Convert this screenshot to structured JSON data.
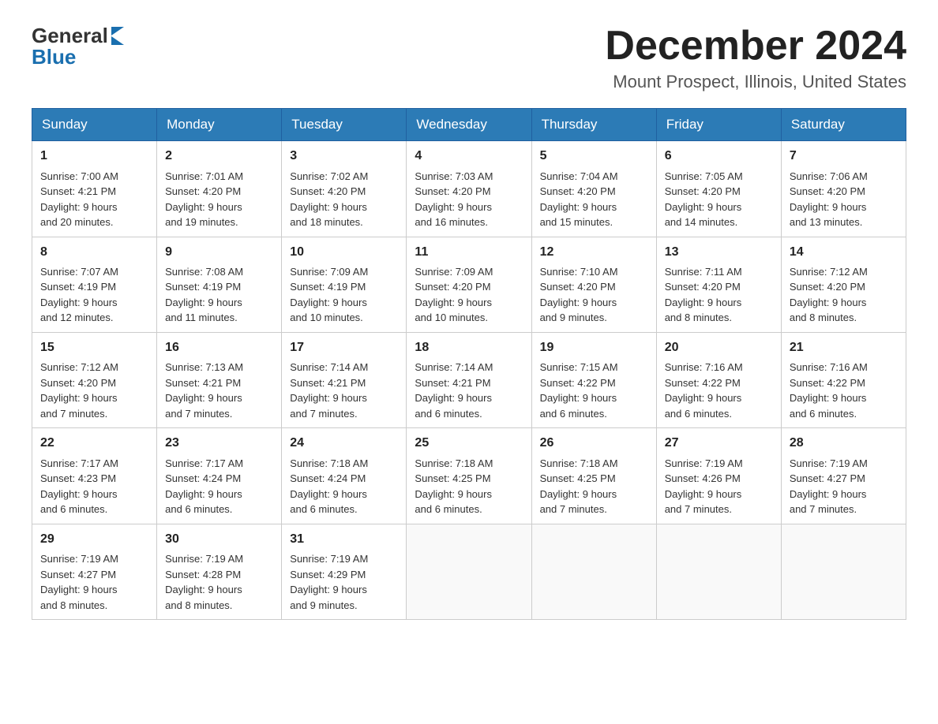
{
  "header": {
    "logo_general": "General",
    "logo_blue": "Blue",
    "month_title": "December 2024",
    "location": "Mount Prospect, Illinois, United States"
  },
  "weekdays": [
    "Sunday",
    "Monday",
    "Tuesday",
    "Wednesday",
    "Thursday",
    "Friday",
    "Saturday"
  ],
  "weeks": [
    [
      {
        "day": "1",
        "sunrise": "7:00 AM",
        "sunset": "4:21 PM",
        "daylight": "9 hours and 20 minutes."
      },
      {
        "day": "2",
        "sunrise": "7:01 AM",
        "sunset": "4:20 PM",
        "daylight": "9 hours and 19 minutes."
      },
      {
        "day": "3",
        "sunrise": "7:02 AM",
        "sunset": "4:20 PM",
        "daylight": "9 hours and 18 minutes."
      },
      {
        "day": "4",
        "sunrise": "7:03 AM",
        "sunset": "4:20 PM",
        "daylight": "9 hours and 16 minutes."
      },
      {
        "day": "5",
        "sunrise": "7:04 AM",
        "sunset": "4:20 PM",
        "daylight": "9 hours and 15 minutes."
      },
      {
        "day": "6",
        "sunrise": "7:05 AM",
        "sunset": "4:20 PM",
        "daylight": "9 hours and 14 minutes."
      },
      {
        "day": "7",
        "sunrise": "7:06 AM",
        "sunset": "4:20 PM",
        "daylight": "9 hours and 13 minutes."
      }
    ],
    [
      {
        "day": "8",
        "sunrise": "7:07 AM",
        "sunset": "4:19 PM",
        "daylight": "9 hours and 12 minutes."
      },
      {
        "day": "9",
        "sunrise": "7:08 AM",
        "sunset": "4:19 PM",
        "daylight": "9 hours and 11 minutes."
      },
      {
        "day": "10",
        "sunrise": "7:09 AM",
        "sunset": "4:19 PM",
        "daylight": "9 hours and 10 minutes."
      },
      {
        "day": "11",
        "sunrise": "7:09 AM",
        "sunset": "4:20 PM",
        "daylight": "9 hours and 10 minutes."
      },
      {
        "day": "12",
        "sunrise": "7:10 AM",
        "sunset": "4:20 PM",
        "daylight": "9 hours and 9 minutes."
      },
      {
        "day": "13",
        "sunrise": "7:11 AM",
        "sunset": "4:20 PM",
        "daylight": "9 hours and 8 minutes."
      },
      {
        "day": "14",
        "sunrise": "7:12 AM",
        "sunset": "4:20 PM",
        "daylight": "9 hours and 8 minutes."
      }
    ],
    [
      {
        "day": "15",
        "sunrise": "7:12 AM",
        "sunset": "4:20 PM",
        "daylight": "9 hours and 7 minutes."
      },
      {
        "day": "16",
        "sunrise": "7:13 AM",
        "sunset": "4:21 PM",
        "daylight": "9 hours and 7 minutes."
      },
      {
        "day": "17",
        "sunrise": "7:14 AM",
        "sunset": "4:21 PM",
        "daylight": "9 hours and 7 minutes."
      },
      {
        "day": "18",
        "sunrise": "7:14 AM",
        "sunset": "4:21 PM",
        "daylight": "9 hours and 6 minutes."
      },
      {
        "day": "19",
        "sunrise": "7:15 AM",
        "sunset": "4:22 PM",
        "daylight": "9 hours and 6 minutes."
      },
      {
        "day": "20",
        "sunrise": "7:16 AM",
        "sunset": "4:22 PM",
        "daylight": "9 hours and 6 minutes."
      },
      {
        "day": "21",
        "sunrise": "7:16 AM",
        "sunset": "4:22 PM",
        "daylight": "9 hours and 6 minutes."
      }
    ],
    [
      {
        "day": "22",
        "sunrise": "7:17 AM",
        "sunset": "4:23 PM",
        "daylight": "9 hours and 6 minutes."
      },
      {
        "day": "23",
        "sunrise": "7:17 AM",
        "sunset": "4:24 PM",
        "daylight": "9 hours and 6 minutes."
      },
      {
        "day": "24",
        "sunrise": "7:18 AM",
        "sunset": "4:24 PM",
        "daylight": "9 hours and 6 minutes."
      },
      {
        "day": "25",
        "sunrise": "7:18 AM",
        "sunset": "4:25 PM",
        "daylight": "9 hours and 6 minutes."
      },
      {
        "day": "26",
        "sunrise": "7:18 AM",
        "sunset": "4:25 PM",
        "daylight": "9 hours and 7 minutes."
      },
      {
        "day": "27",
        "sunrise": "7:19 AM",
        "sunset": "4:26 PM",
        "daylight": "9 hours and 7 minutes."
      },
      {
        "day": "28",
        "sunrise": "7:19 AM",
        "sunset": "4:27 PM",
        "daylight": "9 hours and 7 minutes."
      }
    ],
    [
      {
        "day": "29",
        "sunrise": "7:19 AM",
        "sunset": "4:27 PM",
        "daylight": "9 hours and 8 minutes."
      },
      {
        "day": "30",
        "sunrise": "7:19 AM",
        "sunset": "4:28 PM",
        "daylight": "9 hours and 8 minutes."
      },
      {
        "day": "31",
        "sunrise": "7:19 AM",
        "sunset": "4:29 PM",
        "daylight": "9 hours and 9 minutes."
      },
      null,
      null,
      null,
      null
    ]
  ],
  "labels": {
    "sunrise": "Sunrise: ",
    "sunset": "Sunset: ",
    "daylight": "Daylight: "
  }
}
